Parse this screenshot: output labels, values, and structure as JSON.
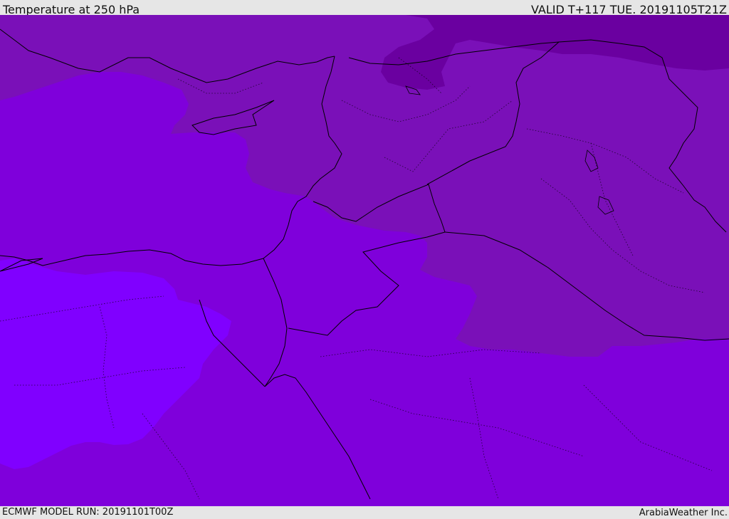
{
  "header": {
    "title": "Temperature at 250 hPa",
    "valid": "VALID T+117 TUE. 20191105T21Z"
  },
  "footer": {
    "model_run": "ECMWF MODEL RUN: 20191101T00Z",
    "credit": "ArabiaWeather Inc."
  },
  "map": {
    "colors": {
      "base": "#7f00db",
      "warm_band": "#8000ff",
      "cool_band": "#7a10b8",
      "coldest_band": "#6a00a0",
      "border": "#000000"
    }
  }
}
